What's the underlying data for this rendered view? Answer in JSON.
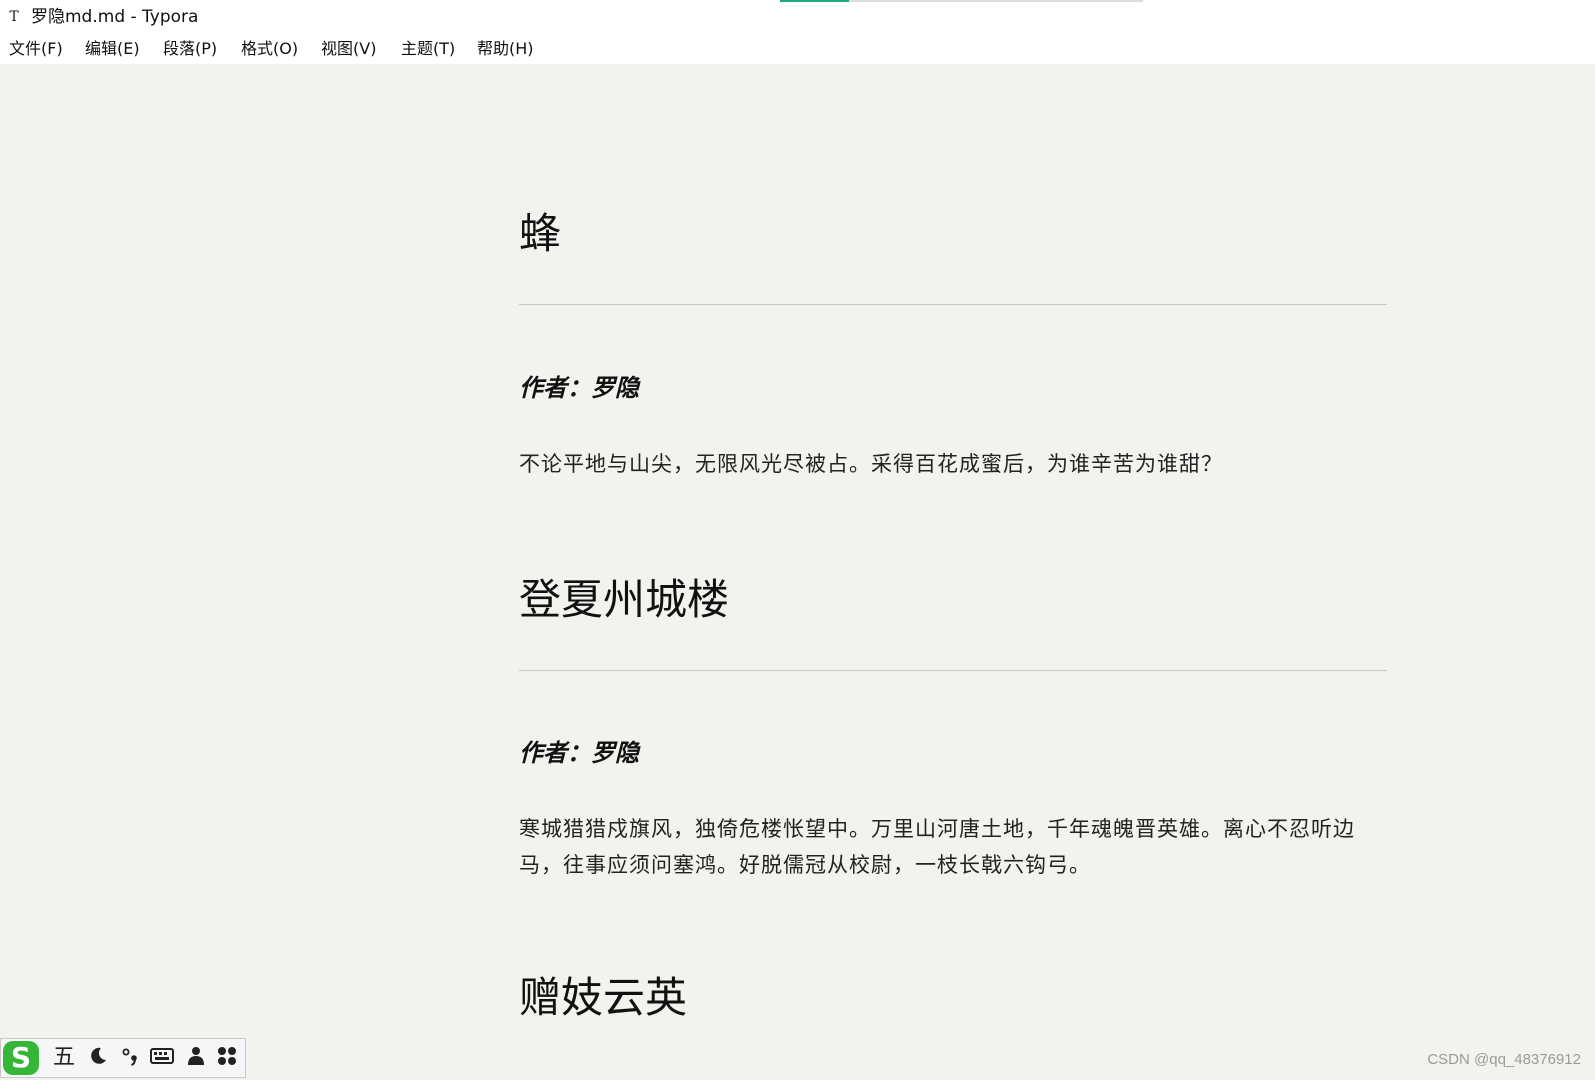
{
  "window": {
    "app_icon": "T",
    "title": "罗隐md.md - Typora",
    "loading_progress": 0.19
  },
  "menu": {
    "items": [
      {
        "label": "文件(F)"
      },
      {
        "label": "编辑(E)"
      },
      {
        "label": "段落(P)"
      },
      {
        "label": "格式(O)"
      },
      {
        "label": "视图(V)"
      },
      {
        "label": "主题(T)"
      },
      {
        "label": "帮助(H)"
      }
    ]
  },
  "document": {
    "poems": [
      {
        "title": "蜂",
        "author": "作者：罗隐",
        "text": "不论平地与山尖，无限风光尽被占。采得百花成蜜后，为谁辛苦为谁甜？"
      },
      {
        "title": "登夏州城楼",
        "author": "作者：罗隐",
        "text": "寒城猎猎戍旗风，独倚危楼怅望中。万里山河唐土地，千年魂魄晋英雄。离心不忍听边马，往事应须问塞鸿。好脱儒冠从校尉，一枝长戟六钩弓。"
      },
      {
        "title": "赠妓云英"
      }
    ]
  },
  "ime_toolbar": {
    "logo": "S",
    "mode": "五",
    "icons": [
      "moon-icon",
      "punctuation-icon",
      "keyboard-icon",
      "user-icon",
      "apps-icon"
    ]
  },
  "watermark": "CSDN @qq_48376912",
  "colors": {
    "background": "#f3f2ee",
    "accent": "#1fa97e",
    "ime_logo": "#36b636"
  }
}
